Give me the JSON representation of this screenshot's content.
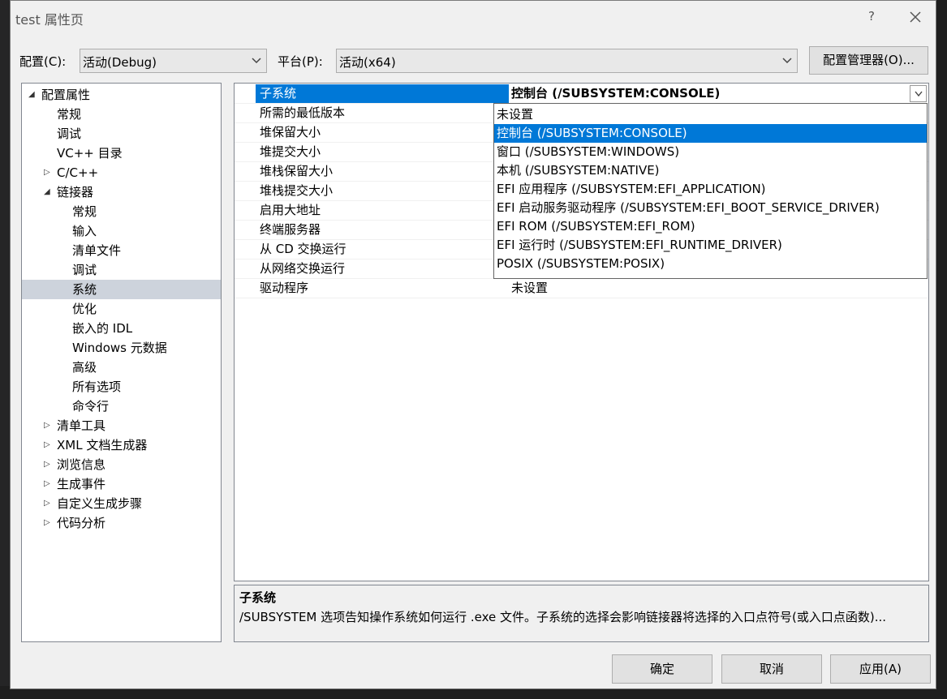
{
  "window": {
    "title": "test 属性页",
    "help_label": "?"
  },
  "config": {
    "config_label": "配置(C):",
    "config_value": "活动(Debug)",
    "platform_label": "平台(P):",
    "platform_value": "活动(x64)",
    "manager_button": "配置管理器(O)..."
  },
  "tree": {
    "items": [
      {
        "label": "配置属性",
        "toggle": "◢"
      },
      {
        "label": "常规"
      },
      {
        "label": "调试"
      },
      {
        "label": "VC++ 目录"
      },
      {
        "label": "C/C++",
        "toggle": "▷"
      },
      {
        "label": "链接器",
        "toggle": "◢"
      },
      {
        "label": "常规"
      },
      {
        "label": "输入"
      },
      {
        "label": "清单文件"
      },
      {
        "label": "调试"
      },
      {
        "label": "系统"
      },
      {
        "label": "优化"
      },
      {
        "label": "嵌入的 IDL"
      },
      {
        "label": "Windows 元数据"
      },
      {
        "label": "高级"
      },
      {
        "label": "所有选项"
      },
      {
        "label": "命令行"
      },
      {
        "label": "清单工具",
        "toggle": "▷"
      },
      {
        "label": "XML 文档生成器",
        "toggle": "▷"
      },
      {
        "label": "浏览信息",
        "toggle": "▷"
      },
      {
        "label": "生成事件",
        "toggle": "▷"
      },
      {
        "label": "自定义生成步骤",
        "toggle": "▷"
      },
      {
        "label": "代码分析",
        "toggle": "▷"
      }
    ]
  },
  "grid": {
    "rows": [
      {
        "name": "子系统",
        "value": "控制台 (/SUBSYSTEM:CONSOLE)"
      },
      {
        "name": "所需的最低版本",
        "value": ""
      },
      {
        "name": "堆保留大小",
        "value": ""
      },
      {
        "name": "堆提交大小",
        "value": ""
      },
      {
        "name": "堆栈保留大小",
        "value": ""
      },
      {
        "name": "堆栈提交大小",
        "value": ""
      },
      {
        "name": "启用大地址",
        "value": ""
      },
      {
        "name": "终端服务器",
        "value": ""
      },
      {
        "name": "从 CD 交换运行",
        "value": ""
      },
      {
        "name": "从网络交换运行",
        "value": ""
      },
      {
        "name": "驱动程序",
        "value": "未设置"
      }
    ]
  },
  "dropdown": {
    "options": [
      "未设置",
      "控制台 (/SUBSYSTEM:CONSOLE)",
      "窗口 (/SUBSYSTEM:WINDOWS)",
      "本机 (/SUBSYSTEM:NATIVE)",
      "EFI 应用程序 (/SUBSYSTEM:EFI_APPLICATION)",
      "EFI 启动服务驱动程序 (/SUBSYSTEM:EFI_BOOT_SERVICE_DRIVER)",
      "EFI ROM (/SUBSYSTEM:EFI_ROM)",
      "EFI 运行时 (/SUBSYSTEM:EFI_RUNTIME_DRIVER)",
      "POSIX (/SUBSYSTEM:POSIX)"
    ]
  },
  "description": {
    "title": "子系统",
    "text": "/SUBSYSTEM 选项告知操作系统如何运行 .exe 文件。子系统的选择会影响链接器将选择的入口点符号(或入口点函数)..."
  },
  "buttons": {
    "ok": "确定",
    "cancel": "取消",
    "apply": "应用(A)"
  }
}
